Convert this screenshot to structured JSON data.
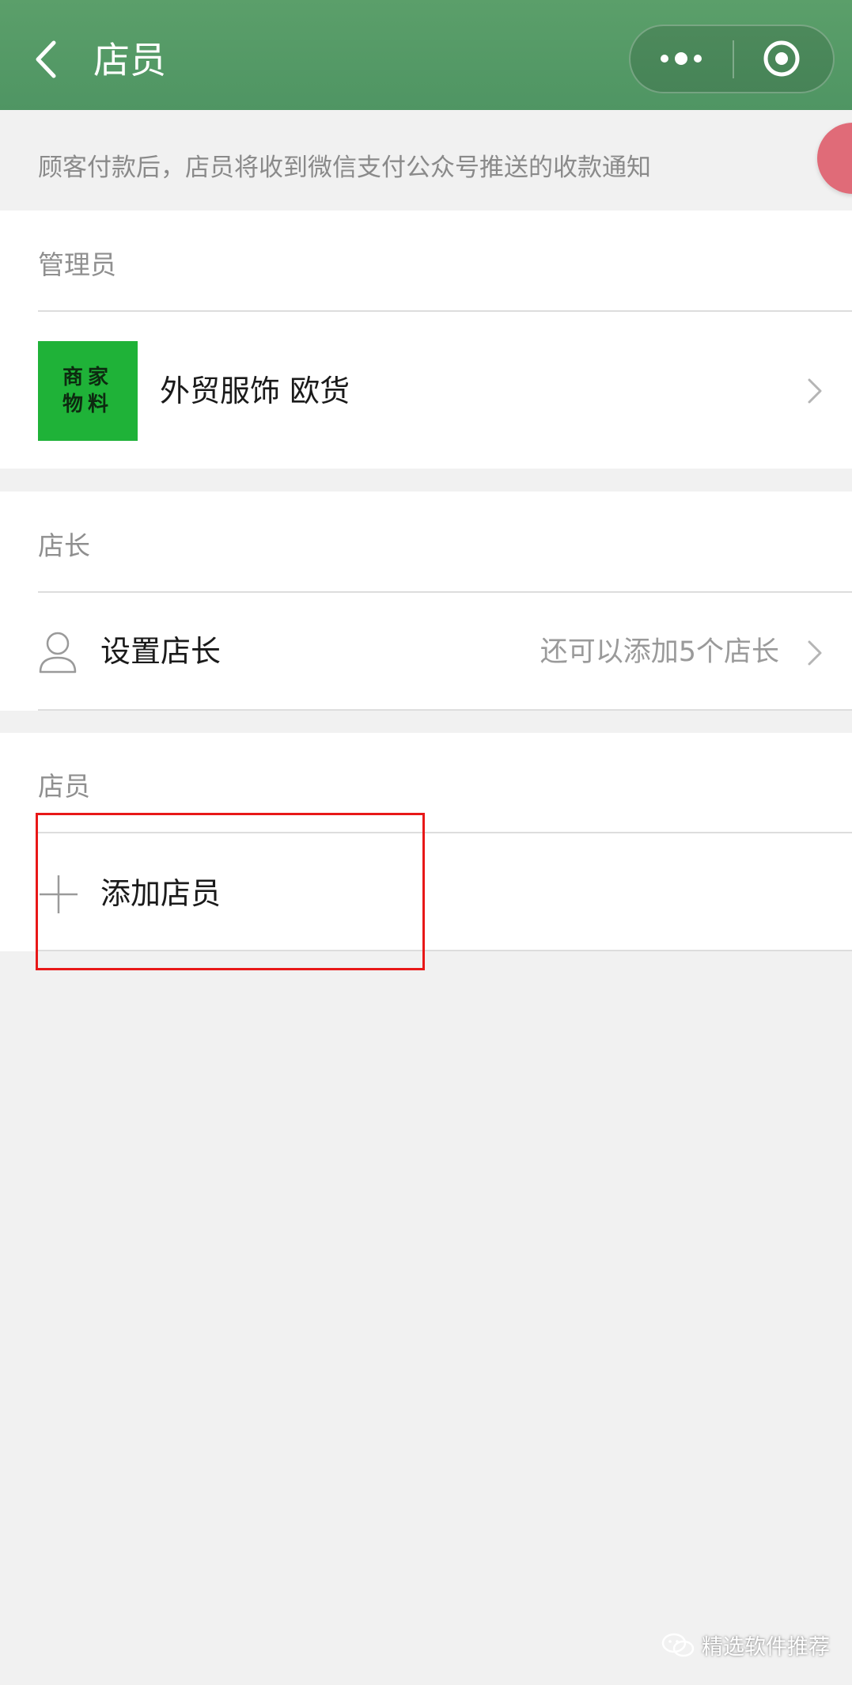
{
  "navbar": {
    "title": "店员",
    "back_icon": "chevron-left-icon",
    "more_icon": "more-dots-icon",
    "close_icon": "target-circle-icon",
    "background": "#55996a"
  },
  "notice": "顾客付款后，店员将收到微信支付公众号推送的收款通知",
  "admin_section": {
    "label": "管理员",
    "logo_line1": "商家",
    "logo_line2": "物料",
    "name": "外贸服饰 欧货"
  },
  "manager_section": {
    "label": "店长",
    "action": "设置店长",
    "hint": "还可以添加5个店长"
  },
  "staff_section": {
    "label": "店员",
    "action": "添加店员"
  },
  "watermark": "精选软件推荐",
  "colors": {
    "highlight": "#e81818",
    "logo_green": "#1fb238"
  }
}
